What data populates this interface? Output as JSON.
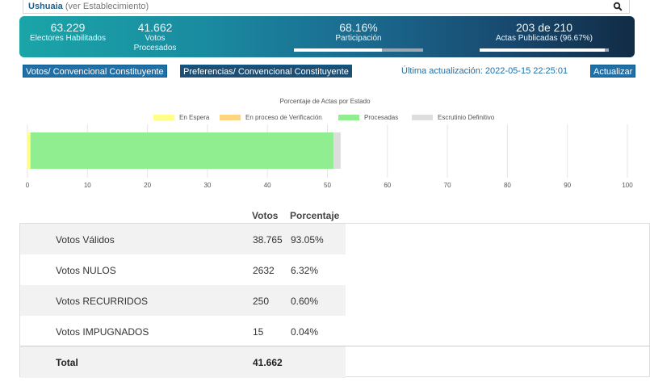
{
  "search": {
    "location": "Ushuaia",
    "hint": "(ver Establecimiento)"
  },
  "stats": {
    "electores_value": "63.229",
    "electores_label": "Electores Habilitados",
    "votos_value": "41.662",
    "votos_label_1": "Votos",
    "votos_label_2": "Procesados",
    "participacion_value": "68.16%",
    "participacion_label": "Participación",
    "participacion_fraction": 0.6816,
    "actas_value": "203 de 210",
    "actas_label": "Actas Publicadas (96.67%)",
    "actas_fraction": 0.9667
  },
  "toolbar": {
    "tab1_label": "Votos/ Convencional Constituyente",
    "tab2_label": "Preferencias/ Convencional Constituyente",
    "update_text": "Última actualización: 2022-05-15 22:25:01",
    "update_button": "Actualizar"
  },
  "chart_data": {
    "type": "bar",
    "orientation": "horizontal-stacked",
    "title": "Porcentaje de Actas por Estado",
    "series": [
      {
        "name": "En Espera",
        "values": [
          0.5
        ],
        "color": "#ffff88"
      },
      {
        "name": "En proceso de Verificación",
        "values": [
          0
        ],
        "color": "#ffd47f"
      },
      {
        "name": "Procesadas",
        "values": [
          50.5
        ],
        "color": "#90ee90"
      },
      {
        "name": "Escrutinio Definitivo",
        "values": [
          1.2
        ],
        "color": "#dddddd"
      }
    ],
    "xlim": [
      0,
      100
    ],
    "xticks": [
      "0",
      "10",
      "20",
      "30",
      "40",
      "50",
      "60",
      "70",
      "80",
      "90",
      "100"
    ],
    "grid": true,
    "legend": "top"
  },
  "table": {
    "header_votes": "Votos",
    "header_pct": "Porcentaje",
    "rows": [
      {
        "name": "Votos Válidos",
        "votes": "38.765",
        "pct": "93.05%"
      },
      {
        "name": "Votos NULOS",
        "votes": "2632",
        "pct": "6.32%"
      },
      {
        "name": "Votos RECURRIDOS",
        "votes": "250",
        "pct": "0.60%"
      },
      {
        "name": "Votos IMPUGNADOS",
        "votes": "15",
        "pct": "0.04%"
      }
    ],
    "total_label": "Total",
    "total_votes": "41.662"
  }
}
